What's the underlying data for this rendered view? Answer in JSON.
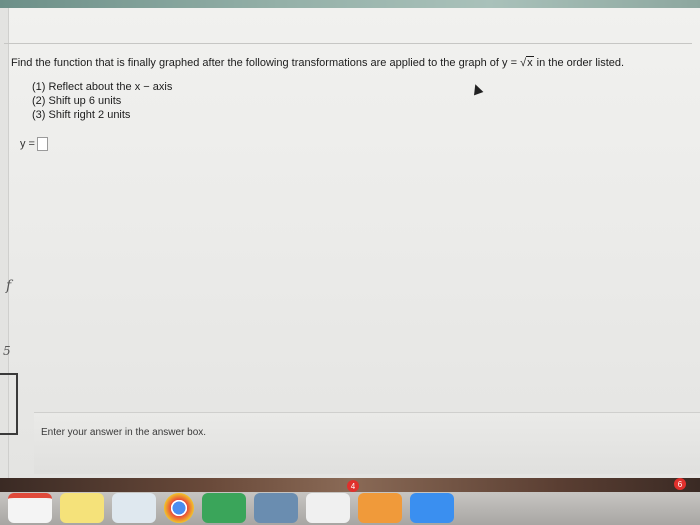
{
  "question": {
    "prompt_before": "Find the function that is finally graphed after the following transformations are applied to the graph of y = ",
    "radical_symbol": "√",
    "radicand": "x",
    "prompt_after": " in the order listed.",
    "steps": [
      "(1)  Reflect about the x − axis",
      "(2)  Shift up 6 units",
      "(3)  Shift right 2 units"
    ],
    "answer_label": "y =",
    "answer_value": ""
  },
  "footer": {
    "instruction": "Enter your answer in the answer box."
  },
  "handwriting": {
    "mark1": "f",
    "mark2": "5"
  },
  "dock": {
    "badge_1": "4",
    "badge_2": "6",
    "icons": [
      "calendar-icon",
      "notes-icon",
      "preview-icon",
      "chrome-icon",
      "facetime-icon",
      "photo-icon",
      "music-icon",
      "books-icon",
      "app-store-icon"
    ]
  },
  "colors": {
    "page_bg": "#ebebe9",
    "text": "#1d1d1d",
    "badge": "#e0302c"
  }
}
